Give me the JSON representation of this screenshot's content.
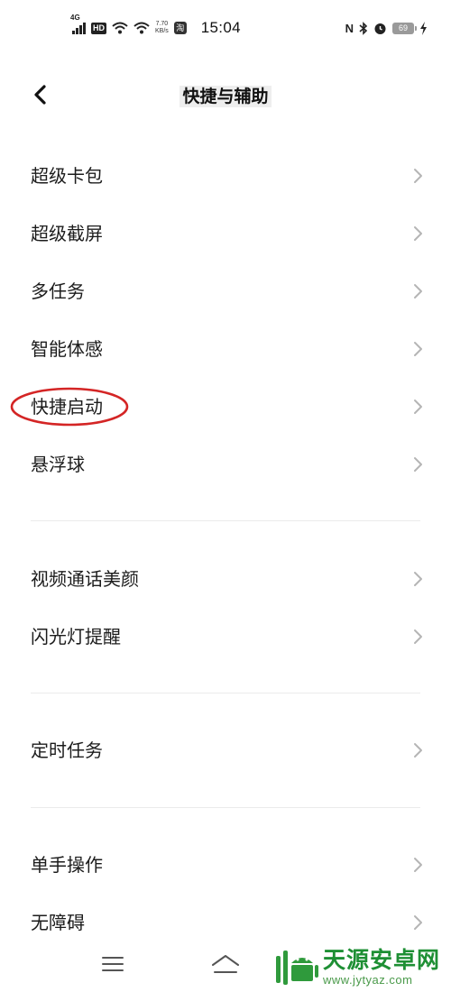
{
  "status_bar": {
    "network": "4G",
    "hd": "HD",
    "speed_value": "7.70",
    "speed_unit": "KB/s",
    "app_icon": "淘",
    "time": "15:04",
    "nfc": "N",
    "battery": "69"
  },
  "header": {
    "title": "快捷与辅助"
  },
  "menu": [
    {
      "label": "超级卡包"
    },
    {
      "label": "超级截屏"
    },
    {
      "label": "多任务"
    },
    {
      "label": "智能体感"
    },
    {
      "label": "快捷启动"
    },
    {
      "label": "悬浮球"
    },
    {
      "label": "视频通话美颜"
    },
    {
      "label": "闪光灯提醒"
    },
    {
      "label": "定时任务"
    },
    {
      "label": "单手操作"
    },
    {
      "label": "无障碍"
    }
  ],
  "watermark": {
    "title": "天源安卓网",
    "url": "www.jytyaz.com"
  },
  "colors": {
    "highlight": "#d42525",
    "watermark": "#1e8f34"
  }
}
